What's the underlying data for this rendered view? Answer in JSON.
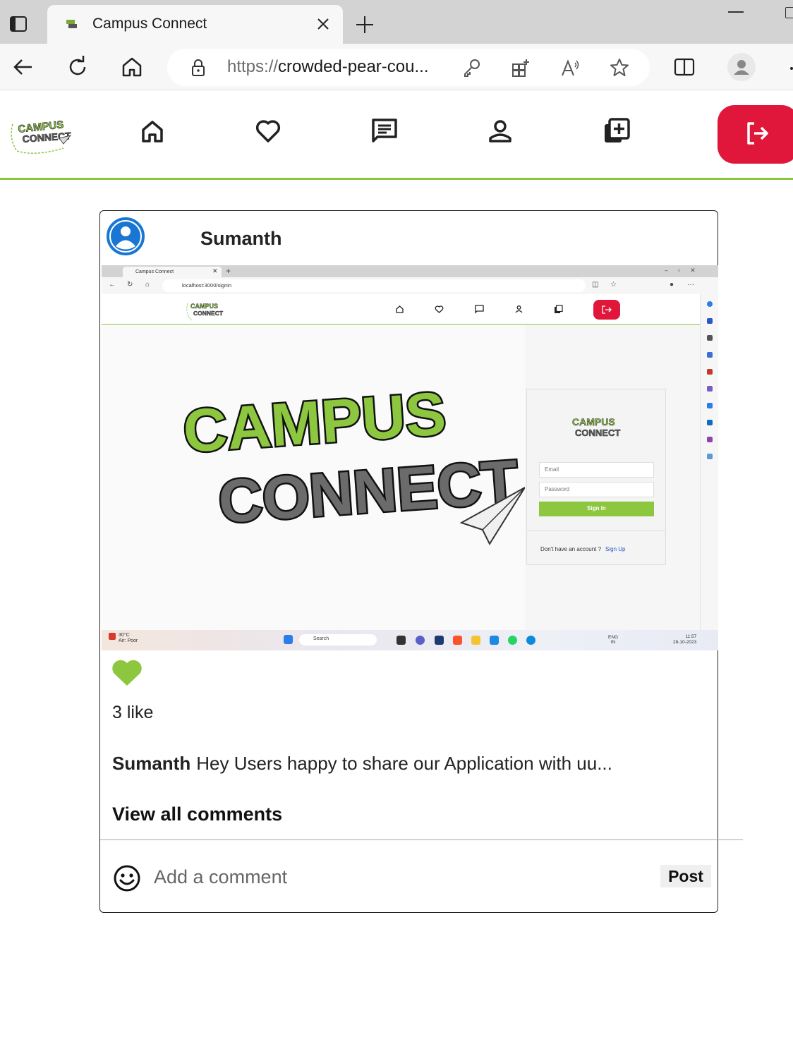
{
  "browser": {
    "tab_title": "Campus Connect",
    "url_scheme": "https://",
    "url_rest": "crowded-pear-cou..."
  },
  "app": {
    "accent_color": "#8dc63f",
    "logout_color": "#e0173a",
    "nav_icons": [
      "home-icon",
      "heart-icon",
      "message-icon",
      "user-icon",
      "add-post-icon",
      "logout-icon"
    ]
  },
  "post": {
    "author": "Sumanth",
    "likes_text": "3 like",
    "caption_author": "Sumanth",
    "caption_text": "Hey Users happy to share our Application with uu...",
    "view_comments": "View all comments",
    "comment_placeholder": "Add a comment",
    "post_label": "Post",
    "image": {
      "tab_title": "Campus Connect",
      "url": "localhost:3000/signin",
      "email_placeholder": "Email",
      "password_placeholder": "Password",
      "signin_label": "Sign In",
      "no_account_text": "Don't have an account ?",
      "signup_label": "Sign Up",
      "weather_temp": "30°C",
      "weather_desc": "Air: Poor",
      "search_label": "Search",
      "lang": "ENG",
      "region": "IN",
      "time": "11:57",
      "date": "28-10-2023"
    }
  }
}
